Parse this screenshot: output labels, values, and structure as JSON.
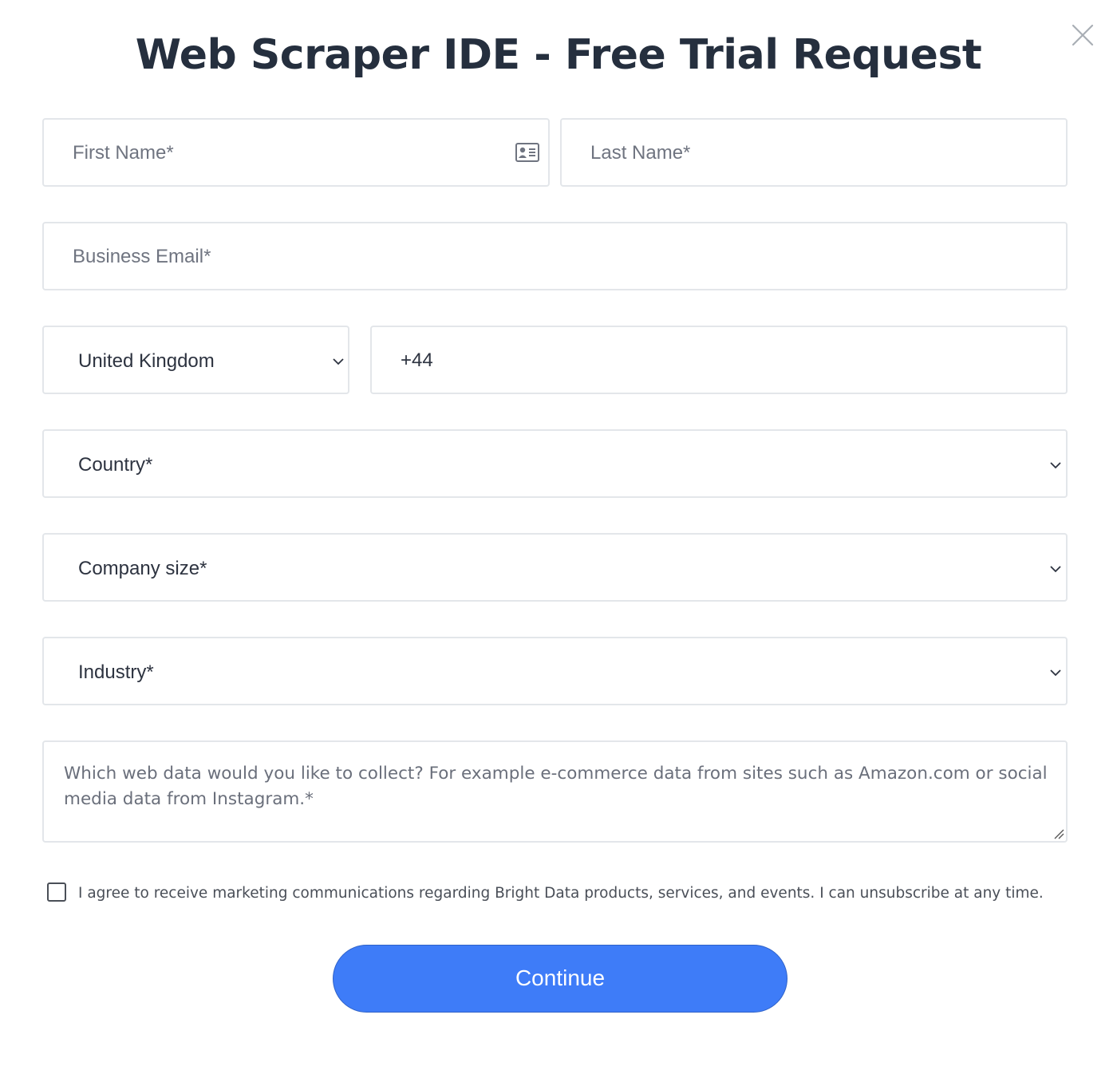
{
  "form": {
    "title": "Web Scraper IDE - Free Trial Request",
    "close_icon": "close-icon",
    "first_name": {
      "placeholder": "First Name*",
      "icon": "contact-card-icon"
    },
    "last_name": {
      "placeholder": "Last Name*"
    },
    "business_email": {
      "placeholder": "Business Email*"
    },
    "phone_country": {
      "selected": "United Kingdom"
    },
    "phone_number": {
      "value": "+44"
    },
    "country": {
      "selected": "Country*"
    },
    "company_size": {
      "selected": "Company size*"
    },
    "industry": {
      "selected": "Industry*"
    },
    "data_needs": {
      "placeholder": "Which web data would you like to collect? For example e-commerce data from sites such as Amazon.com or social media data from Instagram.*"
    },
    "marketing_consent": {
      "checked": false,
      "label": "I agree to receive marketing communications regarding Bright Data products, services, and events. I can unsubscribe at any time."
    },
    "continue_label": "Continue"
  },
  "colors": {
    "button": "#3e7cf8",
    "border": "#e3e6ea",
    "title": "#252f3e"
  }
}
